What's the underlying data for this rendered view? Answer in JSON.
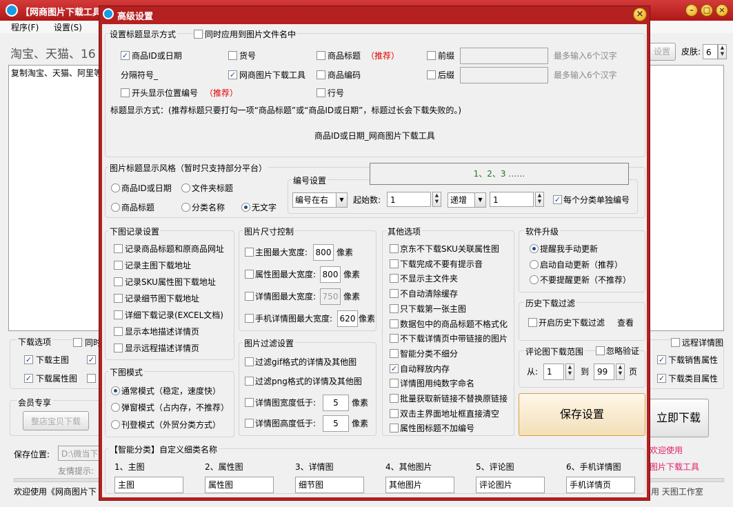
{
  "main": {
    "title": "【网商图片下载工具】",
    "menu": [
      "程序(F)",
      "设置(S)"
    ],
    "banner": "淘宝、天猫、16",
    "textarea_text": "复制淘宝、天猫、阿里等",
    "btn_settings": "设置",
    "skin_label": "皮肤:",
    "skin_value": "6",
    "download_options_title": "下载选项",
    "same_label": "同时",
    "cb_main_image": "下载主图",
    "cb_attr_image": "下载属性图",
    "remote_detail": "远程详情图",
    "cb_sales_attr": "下载销售属性",
    "cb_category_attr": "下载类目属性",
    "member_title": "会员专享",
    "btn_store_download": "整店宝贝下载",
    "btn_download_now": "立即下载",
    "save_location_label": "保存位置:",
    "save_location_value": "D:\\微当下",
    "tip_label": "友情提示:",
    "welcome_right": "欢迎使用",
    "app_name_right": "图片下载工具",
    "status_text": "欢迎使用《网商图片下",
    "status_right": "用 天图工作室"
  },
  "dialog": {
    "title": "高级设置",
    "sec1": {
      "title": "设置标题显示方式",
      "also_filename": "同时应用到图片文件名中",
      "cb_product_id": "商品ID或日期",
      "cb_item_no": "货号",
      "cb_product_title": "商品标题",
      "recommend": "（推荐）",
      "cb_prefix": "前缀",
      "max6": "最多输入6个汉字",
      "separator_label": "分隔符号_",
      "cb_tool_name": "网商图片下载工具",
      "cb_product_code": "商品编码",
      "cb_suffix": "后缀",
      "cb_position_no": "开头显示位置编号",
      "recommend2": "（推荐）",
      "cb_row_no": "行号",
      "instruction": "标题显示方式：(推荐标题只要打勾一项“商品标题”或“商品ID或日期”，标题过长会下载失败的。)",
      "preview": "商品ID或日期_网商图片下载工具"
    },
    "sec2": {
      "title": "图片标题显示风格（暂时只支持部分平台）",
      "rb_product_id": "商品ID或日期",
      "rb_folder_title": "文件夹标题",
      "rb_product_title": "商品标题",
      "rb_category": "分类名称",
      "rb_no_text": "无文字",
      "numbering_title": "编号设置",
      "numbering_preview": "1、2、3 ……",
      "position_combo": "编号在右",
      "start_label": "起始数:",
      "start_value": "1",
      "order_combo": "递增",
      "step_value": "1",
      "cb_per_category": "每个分类单独编号"
    },
    "record": {
      "title": "下图记录设置",
      "items": [
        "记录商品标题和原商品网址",
        "记录主图下载地址",
        "记录SKU属性图下载地址",
        "记录细节图下载地址",
        "详细下载记录(EXCEL文档)",
        "显示本地描述详情页",
        "显示远程描述详情页"
      ]
    },
    "size": {
      "title": "图片尺寸控制",
      "main_w": "主图最大宽度:",
      "main_v": "800",
      "attr_w": "属性图最大宽度:",
      "attr_v": "800",
      "detail_w": "详情图最大宽度:",
      "detail_v": "750",
      "mobile_w": "手机详情图最大宽度:",
      "mobile_v": "620",
      "px": "像素"
    },
    "filter": {
      "title": "图片过滤设置",
      "gif": "过滤gif格式的详情及其他图",
      "png": "过滤png格式的详情及其他图",
      "width_lt": "详情图宽度低于:",
      "width_v": "5",
      "height_lt": "详情图高度低于:",
      "height_v": "5",
      "px": "像素"
    },
    "mode": {
      "title": "下图模式",
      "items": [
        "通常模式（稳定，速度快）",
        "弹窗模式（占内存，不推荐）",
        "刊登模式（外贸分类方式）"
      ]
    },
    "other": {
      "title": "其他选项",
      "items": [
        "京东不下载SKU关联属性图",
        "下载完成不要有提示音",
        "不显示主文件夹",
        "不自动清除缓存",
        "只下载第一张主图",
        "数据包中的商品标题不格式化",
        "不下载详情页中带链接的图片",
        "智能分类不细分",
        "自动释放内存",
        "详情图用纯数字命名",
        "批量获取新链接不替换原链接",
        "双击主界面地址框直接清空",
        "属性图标题不加编号"
      ]
    },
    "upgrade": {
      "title": "软件升级",
      "items": [
        "提醒我手动更新",
        "启动自动更新（推荐）",
        "不要提醒更新（不推荐）"
      ]
    },
    "history": {
      "title": "历史下载过滤",
      "cb": "开启历史下载过滤",
      "view": "查看"
    },
    "review": {
      "title": "评论图下载范围",
      "ignore": "忽略验证",
      "from": "从:",
      "from_v": "1",
      "to": "到",
      "to_v": "99",
      "page": "页"
    },
    "save_button": "保存设置",
    "smart": {
      "title": "【智能分类】自定义细类名称",
      "labels": [
        "1、主图",
        "2、属性图",
        "3、详情图",
        "4、其他图片",
        "5、评论图",
        "6、手机详情图"
      ],
      "values": [
        "主图",
        "属性图",
        "细节图",
        "其他图片",
        "评论图片",
        "手机详情页"
      ]
    }
  },
  "colors": {
    "title_red": "#b52020",
    "recommend": "#e00000",
    "checkmark": "#1b4e8f",
    "numbering_preview": "#1a7a1a"
  }
}
